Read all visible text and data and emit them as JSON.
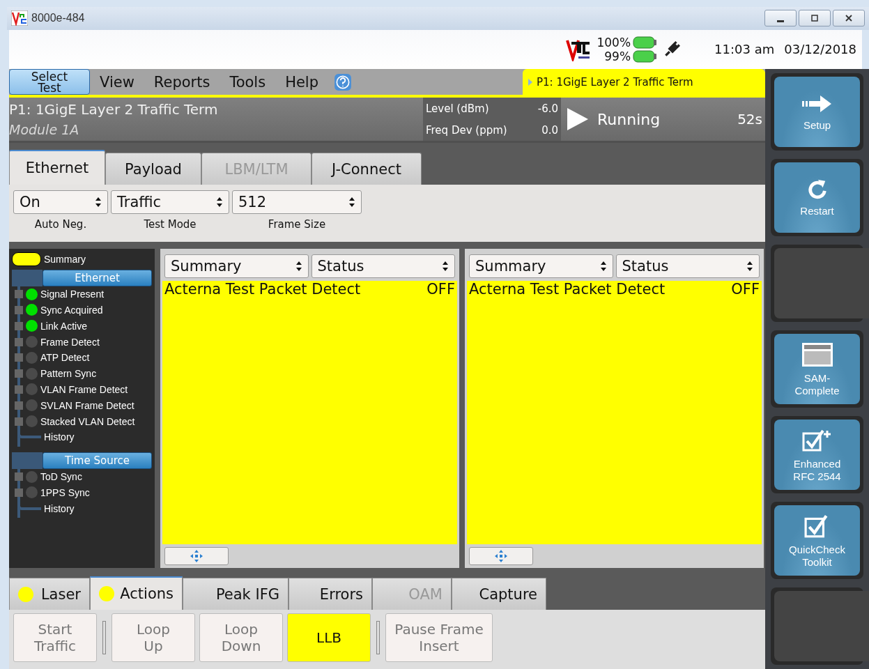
{
  "window": {
    "title": "8000e-484"
  },
  "status": {
    "batteries": [
      {
        "label": "100%"
      },
      {
        "label": "99%"
      }
    ],
    "time": "11:03 am",
    "date": "03/12/2018"
  },
  "menu": {
    "select_test": "Select Test",
    "items": [
      "View",
      "Reports",
      "Tools",
      "Help"
    ]
  },
  "test_tab": "P1: 1GigE Layer 2 Traffic Term",
  "info": {
    "test_name": "P1: 1GigE Layer 2 Traffic Term",
    "module": "Module 1A",
    "readings": [
      {
        "label": "Level (dBm)",
        "value": "-6.0"
      },
      {
        "label": "Freq Dev (ppm)",
        "value": "0.0"
      }
    ],
    "state": "Running",
    "elapsed": "52s"
  },
  "setup_tabs": [
    {
      "label": "Ethernet",
      "selected": true,
      "disabled": false
    },
    {
      "label": "Payload",
      "selected": false,
      "disabled": false
    },
    {
      "label": "LBM/LTM",
      "selected": false,
      "disabled": true
    },
    {
      "label": "J-Connect",
      "selected": false,
      "disabled": false
    }
  ],
  "settings": [
    {
      "value": "On",
      "label": "Auto Neg."
    },
    {
      "value": "Traffic",
      "label": "Test Mode"
    },
    {
      "value": "512",
      "label": "Frame Size"
    }
  ],
  "tree": {
    "summary": "Summary",
    "groups": [
      {
        "label": "Ethernet",
        "children": [
          {
            "label": "Signal Present",
            "lit": true
          },
          {
            "label": "Sync Acquired",
            "lit": true
          },
          {
            "label": "Link Active",
            "lit": true
          },
          {
            "label": "Frame Detect",
            "lit": false
          },
          {
            "label": "ATP Detect",
            "lit": false
          },
          {
            "label": "Pattern Sync",
            "lit": false
          },
          {
            "label": "VLAN Frame Detect",
            "lit": false
          },
          {
            "label": "SVLAN Frame Detect",
            "lit": false
          },
          {
            "label": "Stacked VLAN Detect",
            "lit": false
          }
        ],
        "history": "History"
      },
      {
        "label": "Time Source",
        "children": [
          {
            "label": "ToD Sync",
            "lit": false
          },
          {
            "label": "1PPS Sync",
            "lit": false
          }
        ],
        "history": "History"
      }
    ]
  },
  "panels": [
    {
      "selectors": [
        "Summary",
        "Status"
      ],
      "rows": [
        {
          "label": "Acterna Test Packet Detect",
          "value": "OFF"
        }
      ]
    },
    {
      "selectors": [
        "Summary",
        "Status"
      ],
      "rows": [
        {
          "label": "Acterna Test Packet Detect",
          "value": "OFF"
        }
      ]
    }
  ],
  "bottom_tabs": [
    {
      "label": "Laser",
      "selected": false,
      "led": true,
      "disabled": false
    },
    {
      "label": "Actions",
      "selected": true,
      "led": true,
      "disabled": false
    },
    {
      "label": "Peak IFG",
      "selected": false,
      "led": false,
      "disabled": false
    },
    {
      "label": "Errors",
      "selected": false,
      "led": false,
      "disabled": false
    },
    {
      "label": "OAM",
      "selected": false,
      "led": false,
      "disabled": true
    },
    {
      "label": "Capture",
      "selected": false,
      "led": false,
      "disabled": false
    }
  ],
  "action_groups": [
    {
      "buttons": [
        {
          "label": "Start Traffic",
          "on": false
        }
      ]
    },
    {
      "buttons": [
        {
          "label": "Loop Up",
          "on": false
        },
        {
          "label": "Loop Down",
          "on": false
        },
        {
          "label": "LLB",
          "on": true
        }
      ]
    },
    {
      "buttons": [
        {
          "label": "Pause Frame Insert",
          "on": false
        }
      ]
    }
  ],
  "side_buttons": [
    {
      "kind": "arrow",
      "label": "Setup"
    },
    {
      "kind": "restart",
      "label": "Restart"
    },
    {
      "kind": "empty"
    },
    {
      "kind": "window",
      "label": "SAM-Complete"
    },
    {
      "kind": "check-plus",
      "label": "Enhanced RFC 2544"
    },
    {
      "kind": "check",
      "label": "QuickCheck Toolkit"
    },
    {
      "kind": "empty"
    }
  ]
}
